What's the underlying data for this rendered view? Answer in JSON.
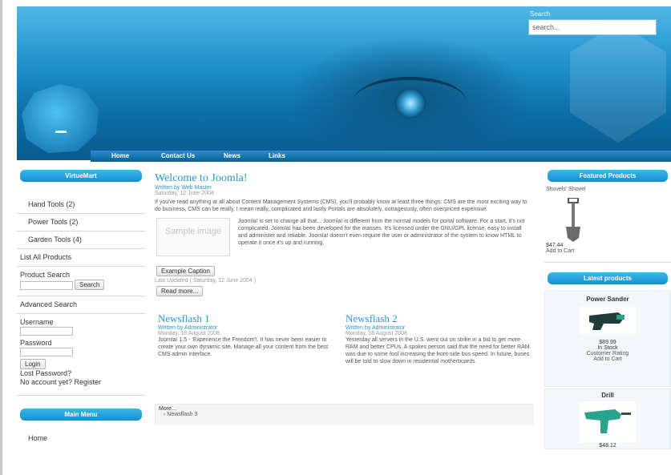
{
  "header": {
    "search_label": "Search",
    "search_placeholder": "search..."
  },
  "nav": [
    "Home",
    "Contact Us",
    "News",
    "Links"
  ],
  "left": {
    "vm_title": "VirtueMart",
    "categories": [
      "Hand Tools (2)",
      "Power Tools (2)",
      "Garden Tools (4)"
    ],
    "list_all": "List All Products",
    "product_search_label": "Product Search",
    "search_button": "Search",
    "advanced_search": "Advanced Search",
    "username_label": "Username",
    "password_label": "Password",
    "login_button": "Login",
    "lost_password": "Lost Password?",
    "no_account": "No account yet? Register",
    "main_menu_title": "Main Menu",
    "main_menu_items": [
      "Home"
    ]
  },
  "main": {
    "title": "Welcome to Joomla!",
    "written_by": "Written by Web Master",
    "date": "Saturday, 12 June 2004",
    "intro": "If you've read anything at all about Content Management Systems (CMS), you'll probably know at least three things: CMS are the most exciting way to do business, CMS can be really, I mean really, complicated and lastly Portals are absolutely, outrageously, often overpriced expensive.",
    "sample_image": "Sample image",
    "body2": "Joomla! is set to change all that... Joomla! is different from the normal models for portal software. For a start, it's not complicated. Joomla! has been developed for the masses. It's licensed under the GNU/GPL license, easy to install and administer and reliable. Joomla! doesn't even require the user or administrator of the system to know HTML to operate it once it's up and running.",
    "caption": "Example Caption",
    "last_updated": "Last Updated ( Saturday, 12 June 2004 )",
    "read_more": "Read more...",
    "news1_title": "Newsflash 1",
    "news1_author": "Written by Administrator",
    "news1_date": "Monday, 18 August 2008",
    "news1_body": "Joomla! 1.5 - 'Experience the Freedom'!. It has never been easier to create your own dynamic site. Manage all your content from the best CMS admin interface.",
    "news2_title": "Newsflash 2",
    "news2_author": "Written by Administrator",
    "news2_date": "Monday, 18 August 2008",
    "news2_body": "Yesterday all servers in the U.S. went out on strike in a bid to get more RAM and better CPUs. A spokes person said that the need for better RAM was due to some fool increasing the front-side bus speed. In future, buses will be told to slow down in residential motherboards.",
    "more_label": "More...",
    "more_items": [
      "Newsflash 3"
    ]
  },
  "right": {
    "featured_title": "Featured Products",
    "featured_name": "Shovels' Shovel",
    "featured_price": "$47.44",
    "featured_add": "Add to Cart",
    "latest_title": "Latest products",
    "latest_items": [
      {
        "name": "Power Sander",
        "price": "$89.99",
        "stock": "In Stock",
        "rating": "Customer Rating",
        "add": "Add to Cart"
      },
      {
        "name": "Drill",
        "price": "$48.12",
        "stock": "",
        "rating": "",
        "add": ""
      }
    ]
  },
  "colors": {
    "accent": "#2a95cf",
    "header": "#1e8fca",
    "panel": "#1390d2"
  }
}
